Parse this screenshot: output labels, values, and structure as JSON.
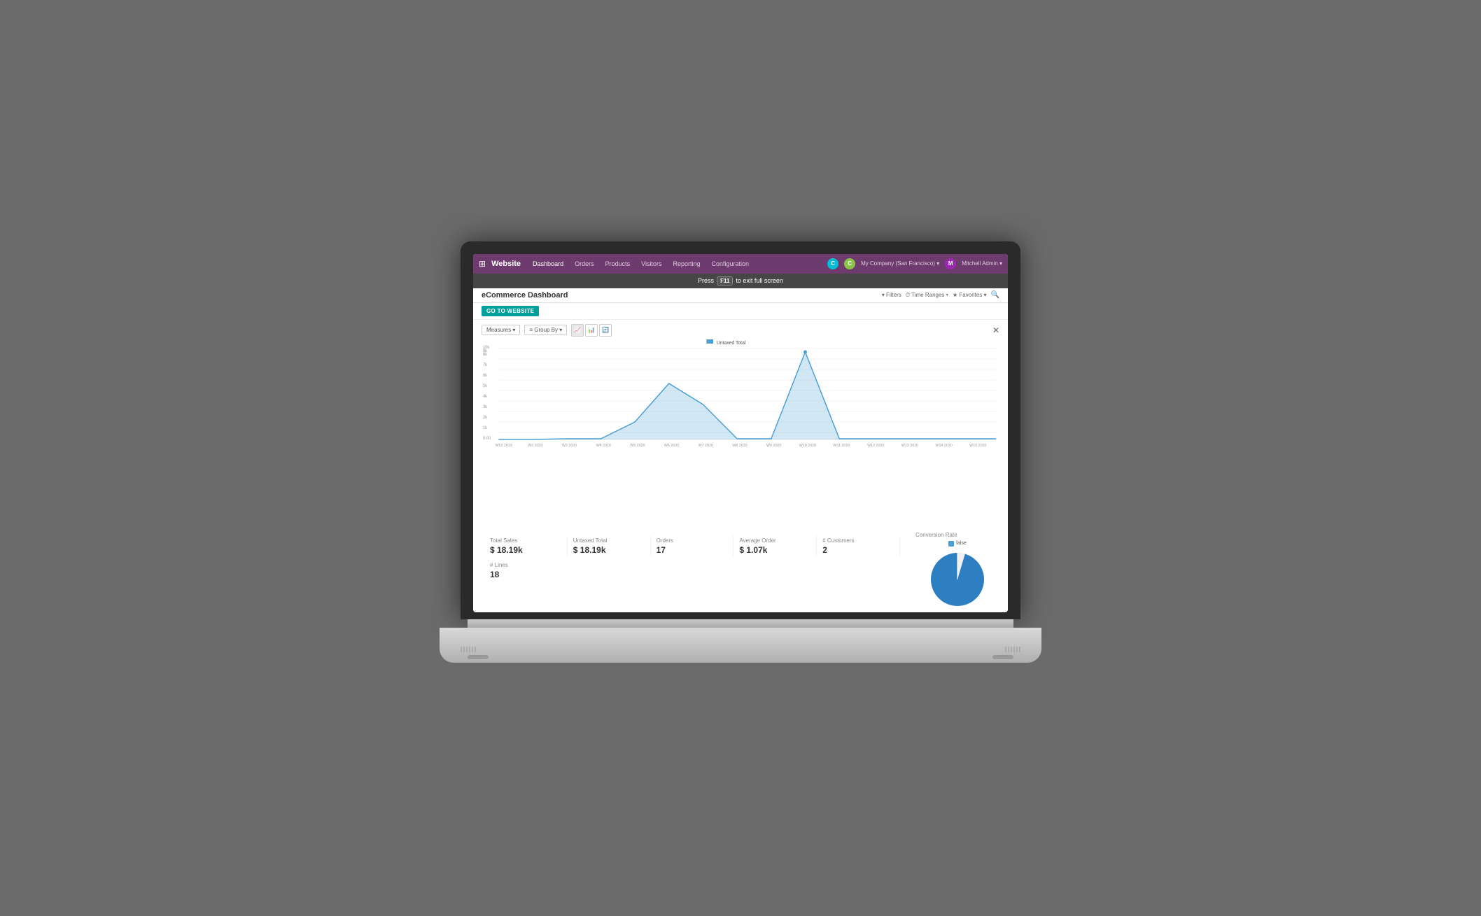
{
  "nav": {
    "brand": "Website",
    "links": [
      "Dashboard",
      "Orders",
      "Products",
      "Visitors",
      "Reporting",
      "Configuration"
    ],
    "company": "My Company (San Francisco) ▾",
    "user": "Mitchell Admin ▾",
    "icon1_color": "#00bcd4",
    "icon2_color": "#8bc34a"
  },
  "fullscreen": {
    "press": "Press",
    "key": "F11",
    "message": "to exit full screen"
  },
  "subnav": {
    "title": "eCommerce Dashboard",
    "filters": "▾ Filters",
    "time_ranges": "⏱ Time Ranges ▾",
    "favorites": "★ Favorites ▾"
  },
  "actions": {
    "go_to_website": "GO TO WEBSITE"
  },
  "chart_controls": {
    "measures": "Measures ▾",
    "group_by": "≡ Group By ▾"
  },
  "chart": {
    "legend": "Untaxed Total",
    "x_labels": [
      "W53 2019",
      "W2 2020",
      "W3 2020",
      "W4 2020",
      "W5 2020",
      "W6 2020",
      "W7 2020",
      "W8 2020",
      "W9 2020",
      "W10 2020",
      "W11 2020",
      "W12 2020",
      "W13 2020",
      "W14 2020",
      "W15 2020"
    ],
    "y_labels": [
      "0.00",
      "1k",
      "2k",
      "3k",
      "4k",
      "5k",
      "6k",
      "7k",
      "8k",
      "9k",
      "10k"
    ],
    "color": "#4a9fd4"
  },
  "stats": {
    "total_sales_label": "Total Sales",
    "total_sales_value": "$ 18.19k",
    "untaxed_total_label": "Untaxed Total",
    "untaxed_total_value": "$ 18.19k",
    "orders_label": "Orders",
    "orders_value": "17",
    "avg_order_label": "Average Order",
    "avg_order_value": "$ 1.07k",
    "customers_label": "# Customers",
    "customers_value": "2",
    "lines_label": "# Lines",
    "lines_value": "18"
  },
  "conversion": {
    "title": "Conversion Rate",
    "legend_label": "false",
    "legend_color": "#4a9fd4",
    "pie_main_color": "#2d7fc1",
    "pie_slice_color": "#f0f0f0"
  }
}
